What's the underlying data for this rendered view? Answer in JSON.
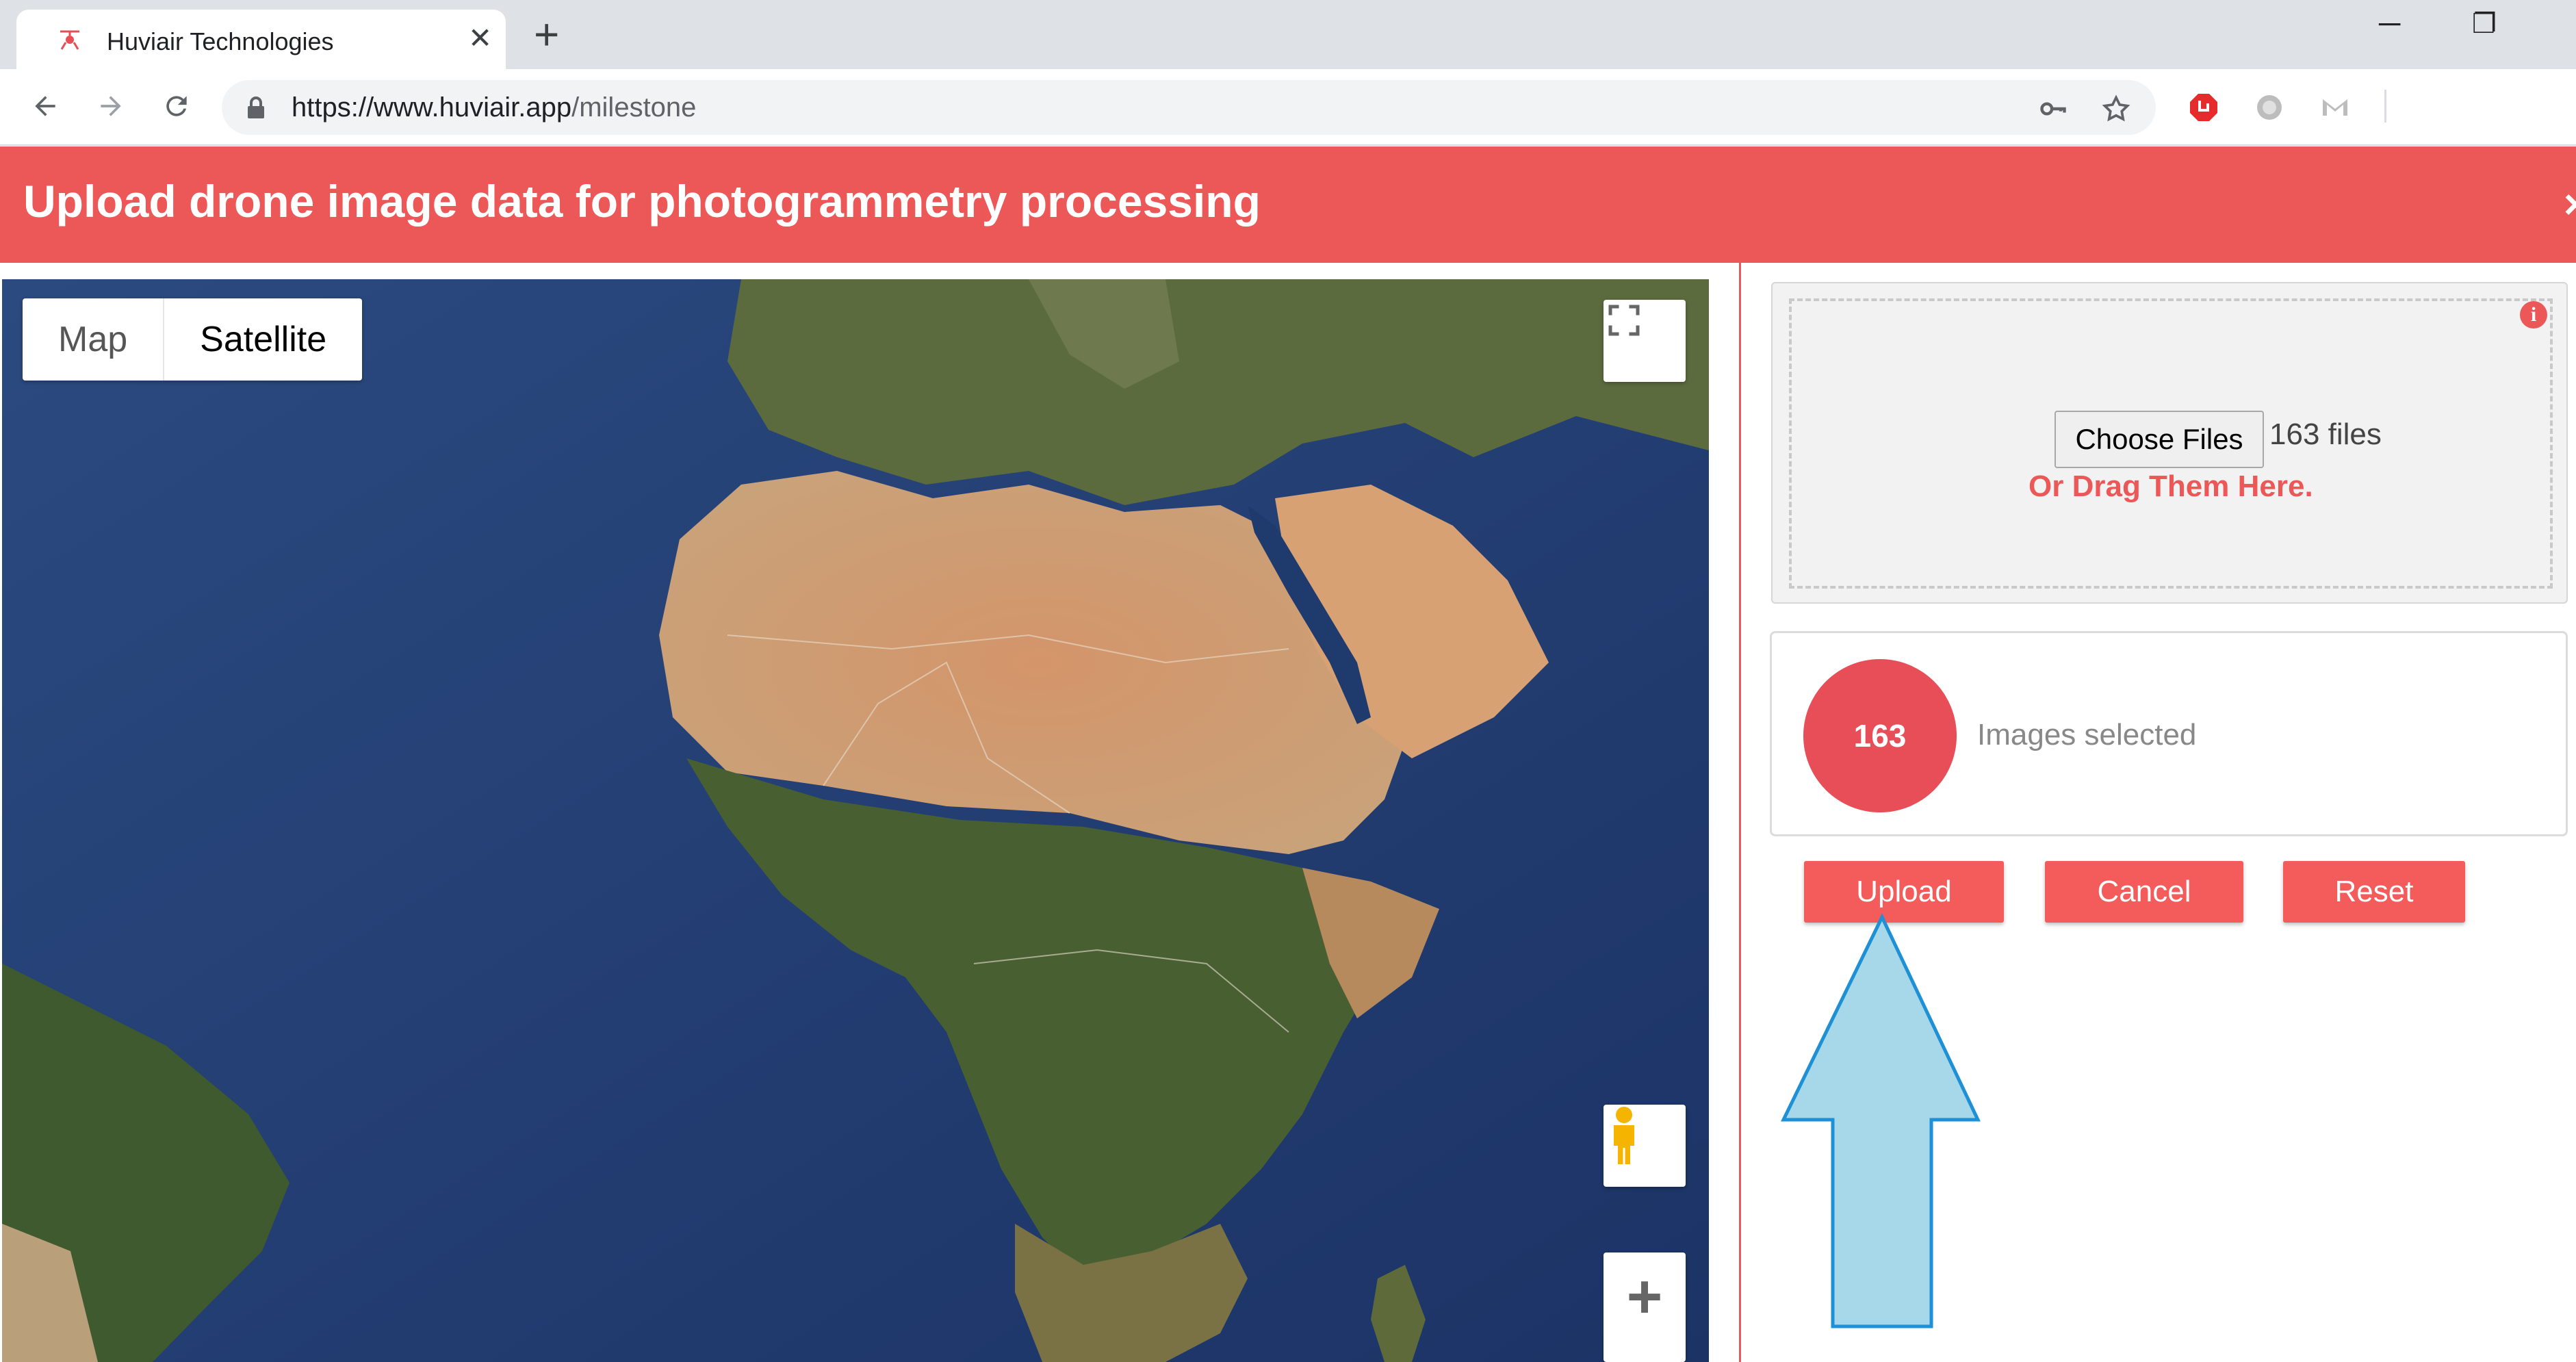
{
  "browser": {
    "tab_title": "Huviair Technologies",
    "url_host": "https://www.huviair.app",
    "url_path": "/milestone"
  },
  "header": {
    "title": "Upload drone image data for photogrammetry processing",
    "close": "×"
  },
  "map": {
    "type_map": "Map",
    "type_satellite": "Satellite",
    "zoom_in": "+"
  },
  "upload": {
    "choose_files_label": "Choose Files",
    "files_status": "163 files",
    "drag_hint": "Or Drag Them Here.",
    "info": "i"
  },
  "selection": {
    "count": "163",
    "label": "Images selected"
  },
  "actions": {
    "upload": "Upload",
    "cancel": "Cancel",
    "reset": "Reset"
  },
  "colors": {
    "accent": "#ec5757",
    "button": "#f45b5b",
    "arrow_fill": "#a6d8ea",
    "arrow_stroke": "#1e90d6"
  }
}
